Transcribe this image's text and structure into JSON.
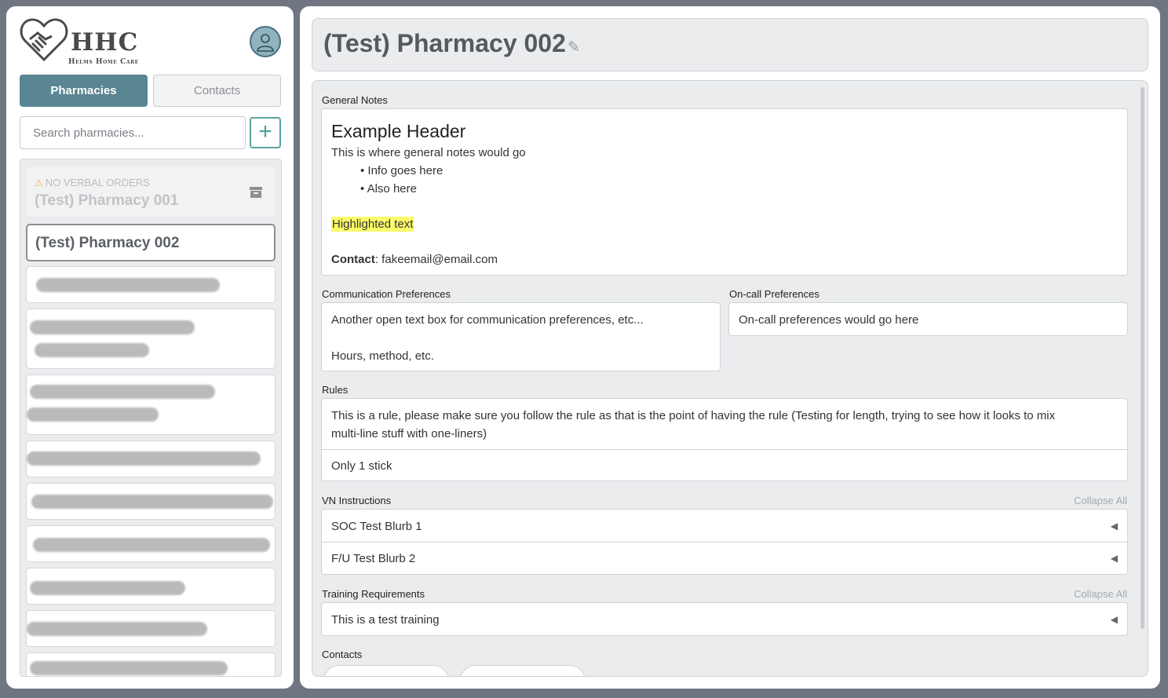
{
  "brand": {
    "name": "HHC",
    "tagline": "Helms Home Care"
  },
  "tabs": {
    "active": "Pharmacies",
    "inactive": "Contacts"
  },
  "search": {
    "placeholder": "Search pharmacies..."
  },
  "add_button": "+",
  "pharmacies": [
    {
      "name": "(Test) Pharmacy 001",
      "warning": "NO VERBAL ORDERS",
      "archived": true
    },
    {
      "name": "(Test) Pharmacy 002",
      "selected": true
    }
  ],
  "page": {
    "title": "(Test) Pharmacy 002"
  },
  "general_notes": {
    "label": "General Notes",
    "header": "Example Header",
    "intro": "This is where general notes would go",
    "bullets": [
      "• Info goes here",
      "• Also here"
    ],
    "highlight": "Highlighted text",
    "contact_label": "Contact",
    "contact_value": ": fakeemail@email.com"
  },
  "communication": {
    "label": "Communication Preferences",
    "line1": "Another open text box for communication preferences, etc...",
    "line2": "Hours, method, etc."
  },
  "oncall": {
    "label": "On-call Preferences",
    "text": "On-call preferences would go here"
  },
  "rules": {
    "label": "Rules",
    "items": [
      "This is a rule, please make sure you follow the rule as that is the point of having the rule (Testing for length, trying to see how it looks to mix",
      "multi-line stuff with one-liners)",
      "Only 1 stick"
    ]
  },
  "vn_instructions": {
    "label": "VN Instructions",
    "collapse": "Collapse All",
    "items": [
      "SOC Test Blurb 1",
      "F/U Test Blurb 2"
    ]
  },
  "training": {
    "label": "Training Requirements",
    "collapse": "Collapse All",
    "items": [
      "This is a test training"
    ]
  },
  "contacts": {
    "label": "Contacts"
  },
  "colors": {
    "accent": "#5a8592",
    "add": "#4aa39d",
    "highlight": "#fbfb68"
  }
}
